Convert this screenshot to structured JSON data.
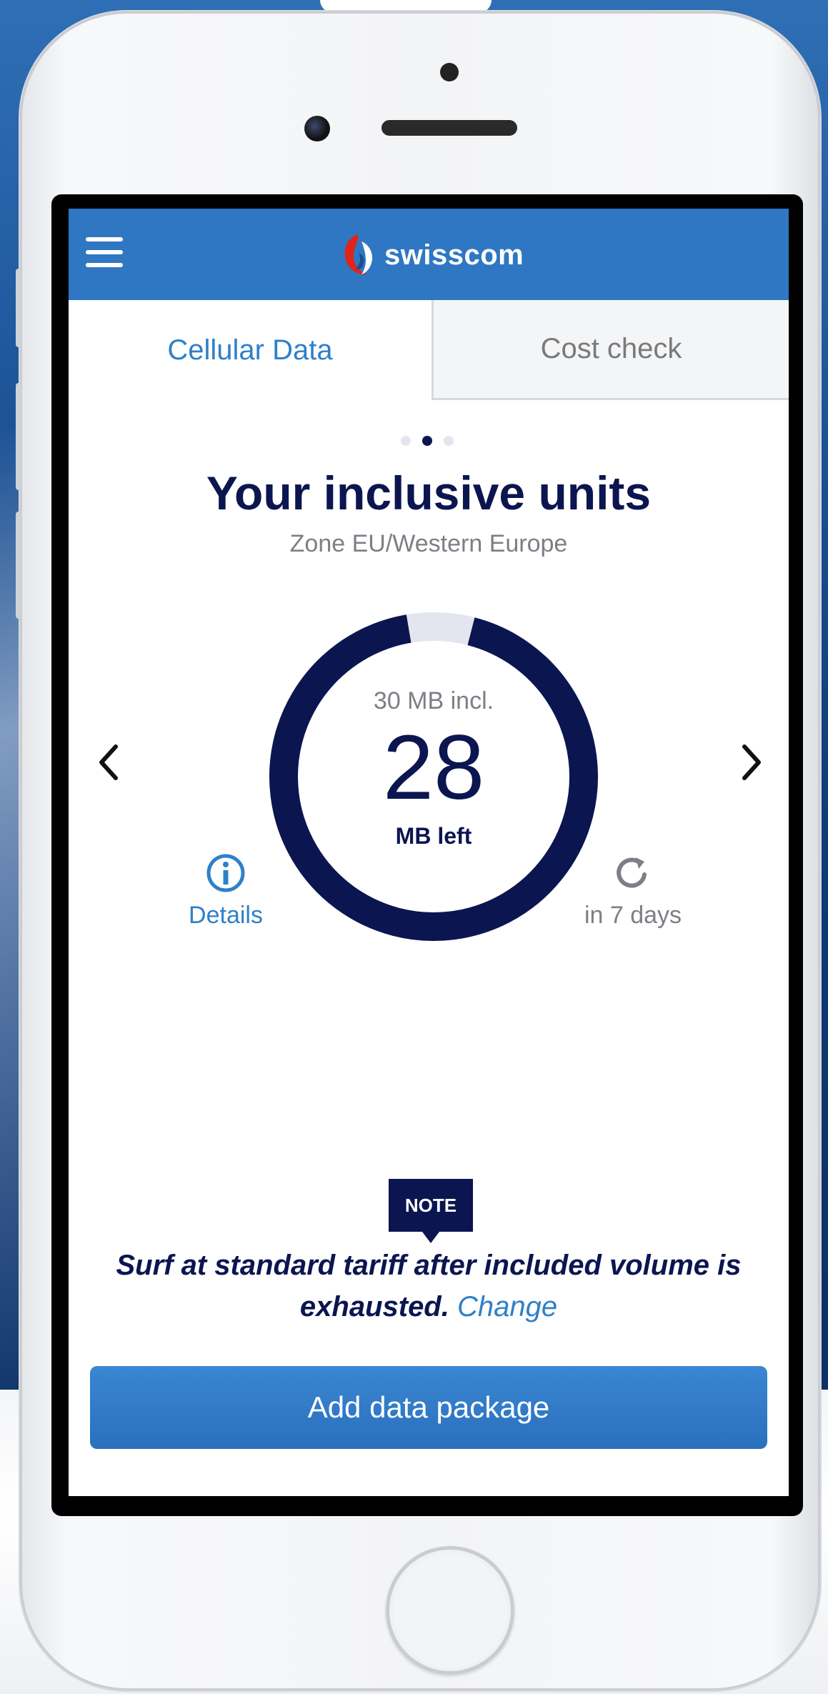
{
  "app": {
    "brand_name": "swisscom",
    "brand_color": "#2f77c2",
    "accent_dark": "#0b1550"
  },
  "tabs": [
    {
      "label": "Cellular Data",
      "active": true
    },
    {
      "label": "Cost check",
      "active": false
    }
  ],
  "pager": {
    "count": 3,
    "active_index": 1
  },
  "main": {
    "title": "Your inclusive units",
    "zone": "Zone EU/Western Europe"
  },
  "usage": {
    "included_label": "30 MB incl.",
    "remaining_value": "28",
    "remaining_unit": "MB left",
    "included_mb": 30,
    "remaining_mb": 28,
    "remaining_fraction": 0.933
  },
  "actions": {
    "details_label": "Details",
    "reset_label": "in 7 days"
  },
  "note": {
    "badge": "NOTE",
    "text": "Surf at standard tariff after included volume is exhausted.",
    "link_label": "Change"
  },
  "cta": {
    "label": "Add data package"
  },
  "icons": {
    "menu": "hamburger-menu-icon",
    "logo": "swisscom-logo-icon",
    "prev": "chevron-left-icon",
    "next": "chevron-right-icon",
    "details": "info-icon",
    "reset": "refresh-icon"
  }
}
